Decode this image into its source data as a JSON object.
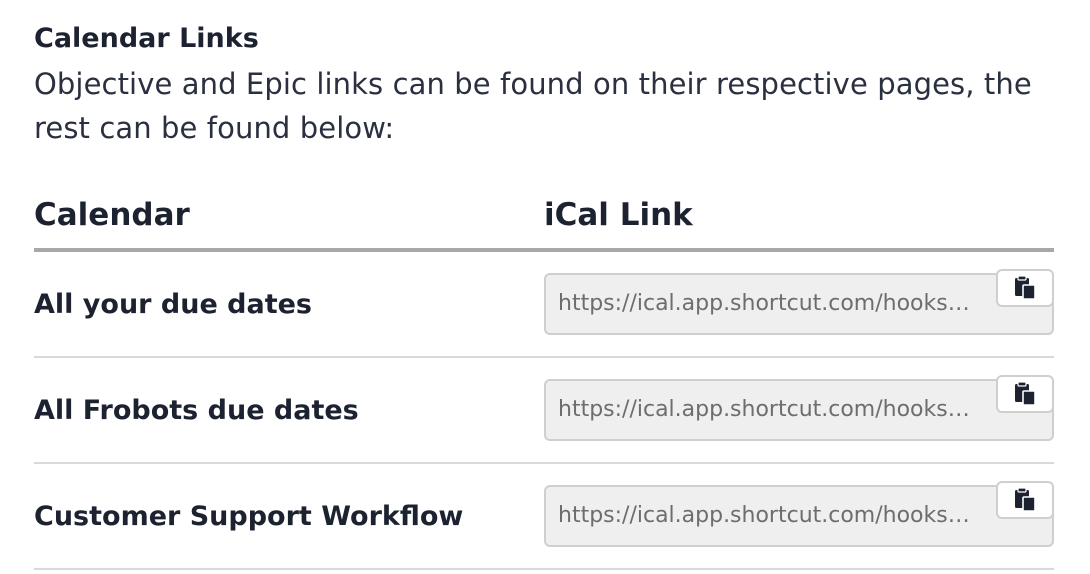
{
  "section": {
    "title": "Calendar Links",
    "description": "Objective and Epic links can be found on their respective pages, the rest can be found below:"
  },
  "table": {
    "headers": [
      "Calendar",
      "iCal Link"
    ],
    "rows": [
      {
        "calendar": "All your due dates",
        "link": "https://ical.app.shortcut.com/hooks/..."
      },
      {
        "calendar": "All Frobots due dates",
        "link": "https://ical.app.shortcut.com/hooks/..."
      },
      {
        "calendar": "Customer Support Workflow",
        "link": "https://ical.app.shortcut.com/hooks/..."
      }
    ]
  },
  "icons": {
    "copy": "clipboard-copy-icon"
  },
  "colors": {
    "text": "#1c2230",
    "input_bg": "#efefef",
    "header_rule": "#a8a8a8",
    "row_rule": "#d9d9d9"
  }
}
